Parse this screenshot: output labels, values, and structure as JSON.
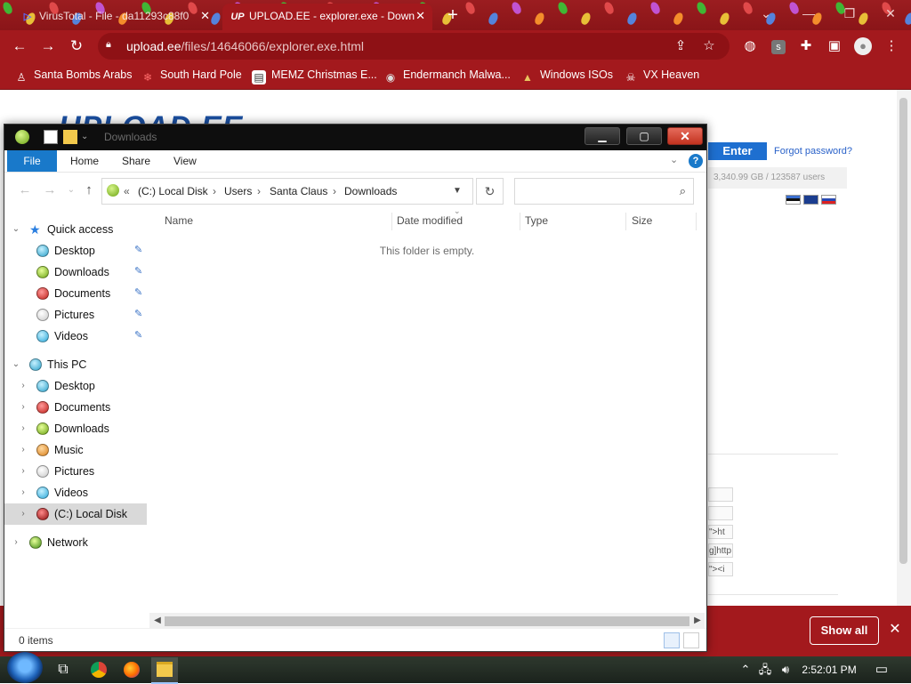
{
  "browser": {
    "tabs": [
      {
        "title": "VirusTotal - File - da11293c88f0",
        "active": false
      },
      {
        "title": "UPLOAD.EE - explorer.exe - Down",
        "active": true,
        "favicon_text": "UP"
      }
    ],
    "new_tab_symbol": "+",
    "url_host": "upload.ee",
    "url_path": "/files/14646066/explorer.exe.html",
    "bookmarks": [
      "Santa Bombs Arabs",
      "South Hard Pole",
      "MEMZ Christmas E...",
      "Endermanch Malwa...",
      "Windows ISOs",
      "VX Heaven"
    ],
    "profile_badge": "s"
  },
  "website": {
    "logo": "UPLOAD.EE",
    "enter_label": "Enter",
    "forgot_label": "Forgot password?",
    "stats_text": "3,340.99 GB  /  123587 users",
    "snippets": [
      "",
      "",
      "\">ht",
      "g]http",
      "\"><i"
    ]
  },
  "downloads_bar": {
    "show_all_label": "Show all",
    "close_symbol": "✕"
  },
  "explorer": {
    "window_title": "Downloads",
    "ribbon_tabs": [
      "File",
      "Home",
      "Share",
      "View"
    ],
    "help_symbol": "?",
    "breadcrumb": {
      "prefix": "«",
      "parts": [
        "(C:) Local Disk",
        "Users",
        "Santa Claus",
        "Downloads"
      ],
      "separator": "›"
    },
    "search_placeholder": "",
    "columns": [
      "Name",
      "Date modified",
      "Type",
      "Size"
    ],
    "empty_message": "This folder is empty.",
    "status_text": "0 items",
    "nav": {
      "quick_access": {
        "label": "Quick access",
        "items": [
          "Desktop",
          "Downloads",
          "Documents",
          "Pictures",
          "Videos"
        ]
      },
      "this_pc": {
        "label": "This PC",
        "items": [
          "Desktop",
          "Documents",
          "Downloads",
          "Music",
          "Pictures",
          "Videos",
          "(C:) Local Disk"
        ]
      },
      "network": {
        "label": "Network"
      }
    }
  },
  "taskbar": {
    "clock": "2:52:01 PM"
  },
  "colors": {
    "chrome_red": "#a3191d",
    "ribbon_blue": "#1979ca",
    "titlebar": "#0e0e0e"
  }
}
